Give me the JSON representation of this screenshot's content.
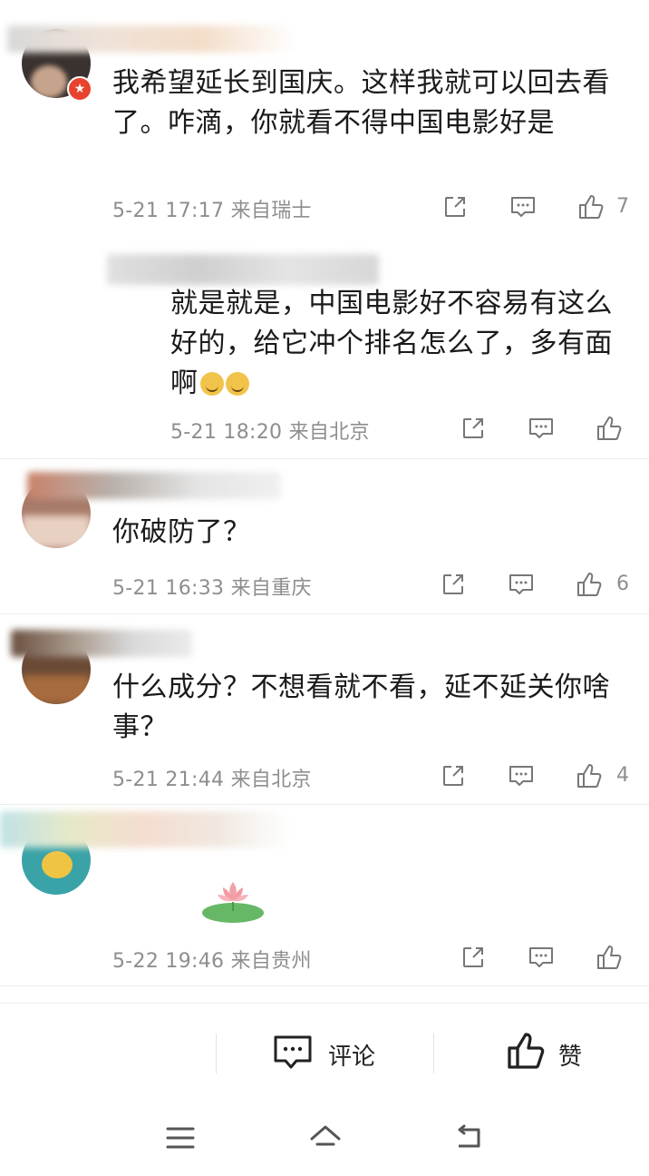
{
  "comments": [
    {
      "content": "我希望延长到国庆。这样我就可以回去看了。咋滴，你就看不得中国电影好是",
      "meta": "5-21 17:17 来自瑞士",
      "likes": "7"
    },
    {
      "content": "就是就是，中国电影好不容易有这么好的，给它冲个排名怎么了，多有面啊",
      "meta": "5-21 18:20 来自北京",
      "likes": ""
    },
    {
      "content": "你破防了？",
      "meta": "5-21 16:33 来自重庆",
      "likes": "6"
    },
    {
      "content": "什么成分？不想看就不看，延不延关你啥事？",
      "meta": "5-21 21:44 来自北京",
      "likes": "4"
    },
    {
      "content": "",
      "meta": "5-22 19:46 来自贵州",
      "likes": ""
    }
  ],
  "bottom_bar": {
    "comment_label": "评论",
    "like_label": "赞"
  },
  "icons": {
    "share": "share-icon",
    "comment": "comment-icon",
    "like": "thumbs-up-icon",
    "nav_menu": "menu-icon",
    "nav_home": "home-icon",
    "nav_back": "back-icon"
  }
}
